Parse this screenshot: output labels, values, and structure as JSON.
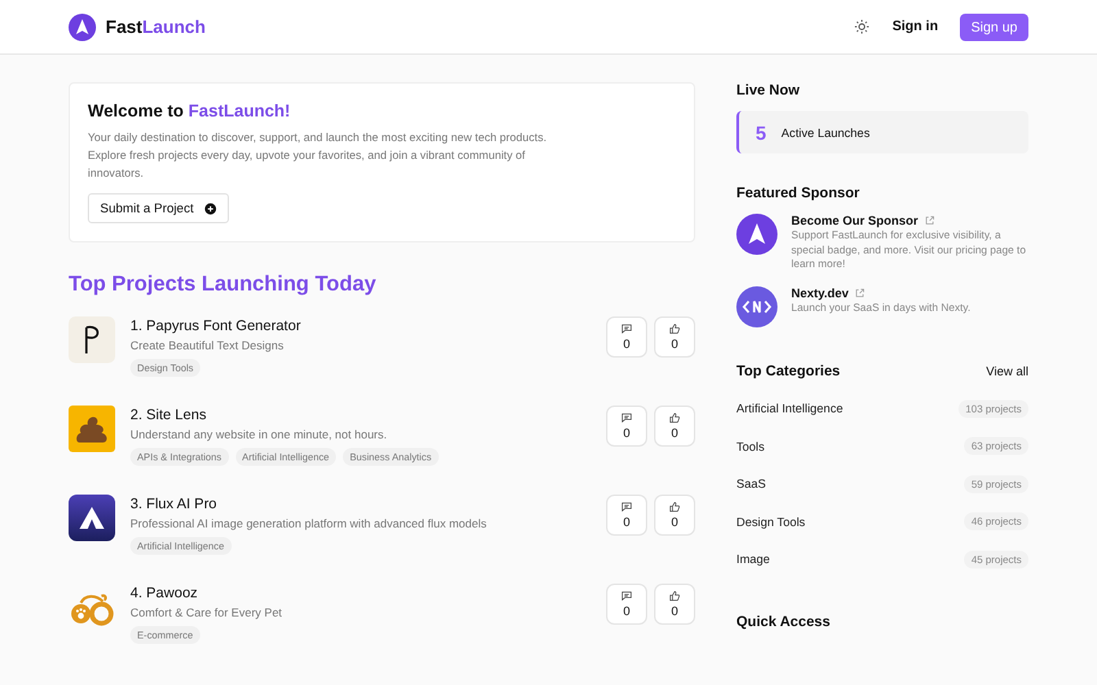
{
  "header": {
    "brand_prefix": "Fast",
    "brand_suffix": "Launch",
    "sign_in": "Sign in",
    "sign_up": "Sign up"
  },
  "welcome": {
    "title_prefix": "Welcome to ",
    "title_brand": "FastLaunch!",
    "text": "Your daily destination to discover, support, and launch the most exciting new tech products. Explore fresh projects every day, upvote your favorites, and join a vibrant community of innovators.",
    "button": "Submit a Project"
  },
  "projects_title": "Top Projects Launching Today",
  "projects": [
    {
      "kind": "flag",
      "title": "1. Papyrus Font Generator",
      "tagline": "Create Beautiful Text Designs",
      "tags": [
        "Design Tools"
      ],
      "comments": "0",
      "upvotes": "0"
    },
    {
      "kind": "blob",
      "title": "2. Site Lens",
      "tagline": "Understand any website in one minute, not hours.",
      "tags": [
        "APIs & Integrations",
        "Artificial Intelligence",
        "Business Analytics"
      ],
      "comments": "0",
      "upvotes": "0"
    },
    {
      "kind": "tent",
      "title": "3. Flux AI Pro",
      "tagline": "Professional AI image generation platform with advanced flux models",
      "tags": [
        "Artificial Intelligence"
      ],
      "comments": "0",
      "upvotes": "0"
    },
    {
      "kind": "paw",
      "title": "4. Pawooz",
      "tagline": "Comfort & Care for Every Pet",
      "tags": [
        "E-commerce"
      ],
      "comments": "0",
      "upvotes": "0"
    }
  ],
  "live_now": {
    "title": "Live Now",
    "count": "5",
    "label": "Active Launches"
  },
  "sponsors": {
    "title": "Featured Sponsor",
    "items": [
      {
        "kind": "arrow",
        "name": "Become Our Sponsor",
        "text": "Support FastLaunch for exclusive visibility, a special badge, and more. Visit our pricing page to learn more!"
      },
      {
        "kind": "code",
        "name": "Nexty.dev",
        "text": "Launch your SaaS in days with Nexty."
      }
    ]
  },
  "categories": {
    "title": "Top Categories",
    "view_all": "View all",
    "items": [
      {
        "name": "Artificial Intelligence",
        "count": "103 projects"
      },
      {
        "name": "Tools",
        "count": "63 projects"
      },
      {
        "name": "SaaS",
        "count": "59 projects"
      },
      {
        "name": "Design Tools",
        "count": "46 projects"
      },
      {
        "name": "Image",
        "count": "45 projects"
      }
    ]
  },
  "quick_access": {
    "title": "Quick Access"
  }
}
